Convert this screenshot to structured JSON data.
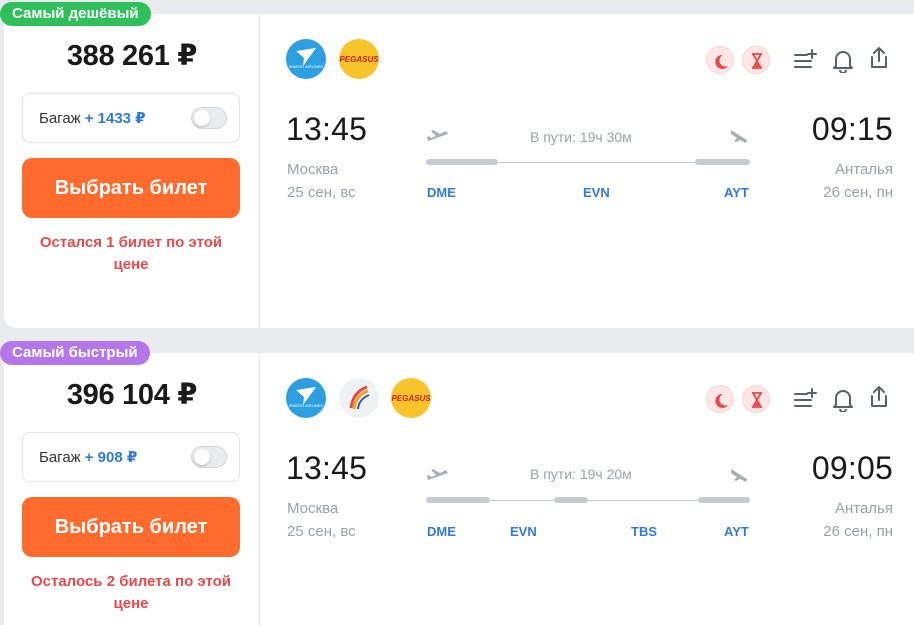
{
  "tickets": [
    {
      "badge": "Самый дешёвый",
      "badge_color": "#2fbf5b",
      "price": "388 261 ₽",
      "baggage_label": "Багаж",
      "baggage_price": "+ 1433 ₽",
      "buy_label": "Выбрать билет",
      "warning_line1": "Остался 1 билет по этой",
      "warning_line2": "цене",
      "airlines": [
        "iraero",
        "pegasus"
      ],
      "departure_time": "13:45",
      "departure_city": "Москва",
      "departure_date": "25 сен, вс",
      "arrival_time": "09:15",
      "arrival_city": "Анталья",
      "arrival_date": "26 сен, пн",
      "duration": "В пути: 19ч 30м",
      "stops": [
        "DME",
        "EVN",
        "AYT"
      ]
    },
    {
      "badge": "Самый быстрый",
      "badge_color": "#b377ea",
      "price": "396 104 ₽",
      "baggage_label": "Багаж",
      "baggage_price": "+ 908 ₽",
      "buy_label": "Выбрать билет",
      "warning_line1": "Осталось 2 билета по этой",
      "warning_line2": "цене",
      "airlines": [
        "iraero",
        "armenia",
        "pegasus"
      ],
      "departure_time": "13:45",
      "departure_city": "Москва",
      "departure_date": "25 сен, вс",
      "arrival_time": "09:05",
      "arrival_city": "Анталья",
      "arrival_date": "26 сен, пн",
      "duration": "В пути: 19ч 20м",
      "stops": [
        "DME",
        "EVN",
        "TBS",
        "AYT"
      ]
    }
  ],
  "airline_logo_text": {
    "iraero": "IRAERO AIRLINES",
    "pegasus": "PEGASUS"
  },
  "icons": [
    "moon-icon",
    "hourglass-icon",
    "add-to-list-icon",
    "bell-icon",
    "share-icon",
    "plane-takeoff-icon",
    "plane-landing-icon"
  ],
  "colors": {
    "accent_orange": "#ff6b2c",
    "link_blue": "#2f7bdb",
    "warning_red": "#e8484a"
  }
}
